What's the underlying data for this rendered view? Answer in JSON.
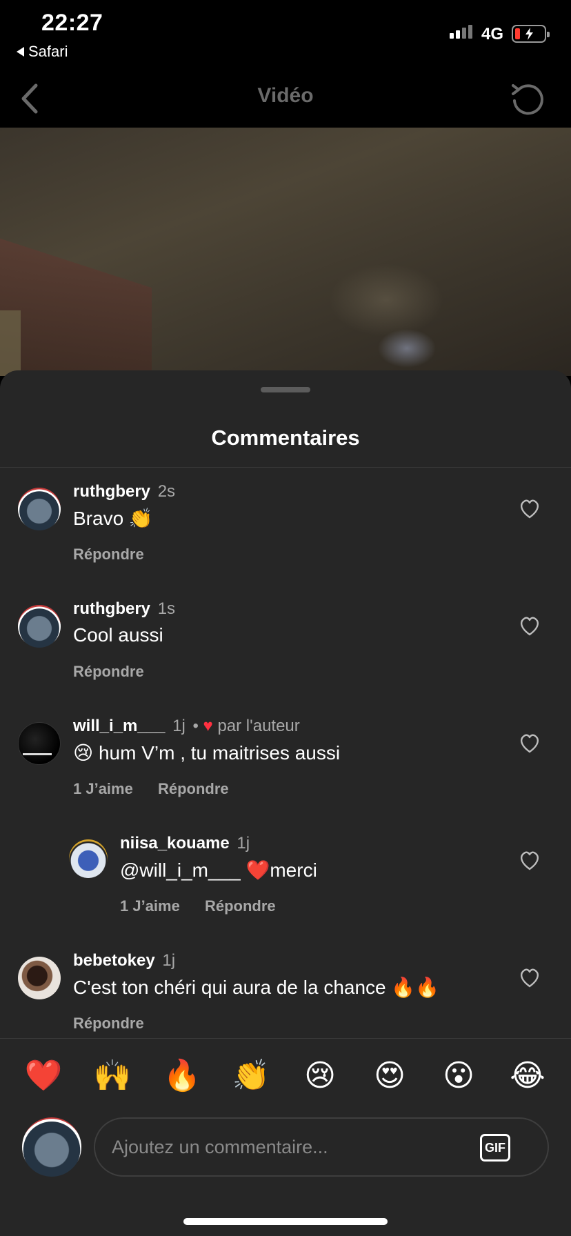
{
  "status_bar": {
    "time": "22:27",
    "back_app": "Safari",
    "network": "4G",
    "battery_level": 0.15
  },
  "nav": {
    "title": "Vidéo"
  },
  "sheet": {
    "title": "Commentaires"
  },
  "comments": [
    {
      "user": "ruthgbery",
      "time": "2s",
      "text": "Bravo 👏",
      "reply": "Répondre"
    },
    {
      "user": "ruthgbery",
      "time": "1s",
      "text": "Cool aussi",
      "reply": "Répondre"
    },
    {
      "user": "will_i_m___",
      "time": "1j",
      "separator": "•",
      "author_like": "par l'auteur",
      "text": "😢 hum V’m , tu maitrises aussi",
      "likes": "1 J’aime",
      "reply": "Répondre"
    },
    {
      "user": "niisa_kouame",
      "time": "1j",
      "text": "@will_i_m___ ❤️merci",
      "likes": "1 J’aime",
      "reply": "Répondre"
    },
    {
      "user": "bebetokey",
      "time": "1j",
      "text": "C'est ton chéri qui aura de la chance 🔥🔥",
      "reply": "Répondre"
    }
  ],
  "emoji_bar": [
    "❤️",
    "🙌",
    "🔥",
    "👏",
    "😢",
    "😍",
    "😮",
    "😂"
  ],
  "composer": {
    "placeholder": "Ajoutez un commentaire...",
    "gif_label": "GIF"
  }
}
